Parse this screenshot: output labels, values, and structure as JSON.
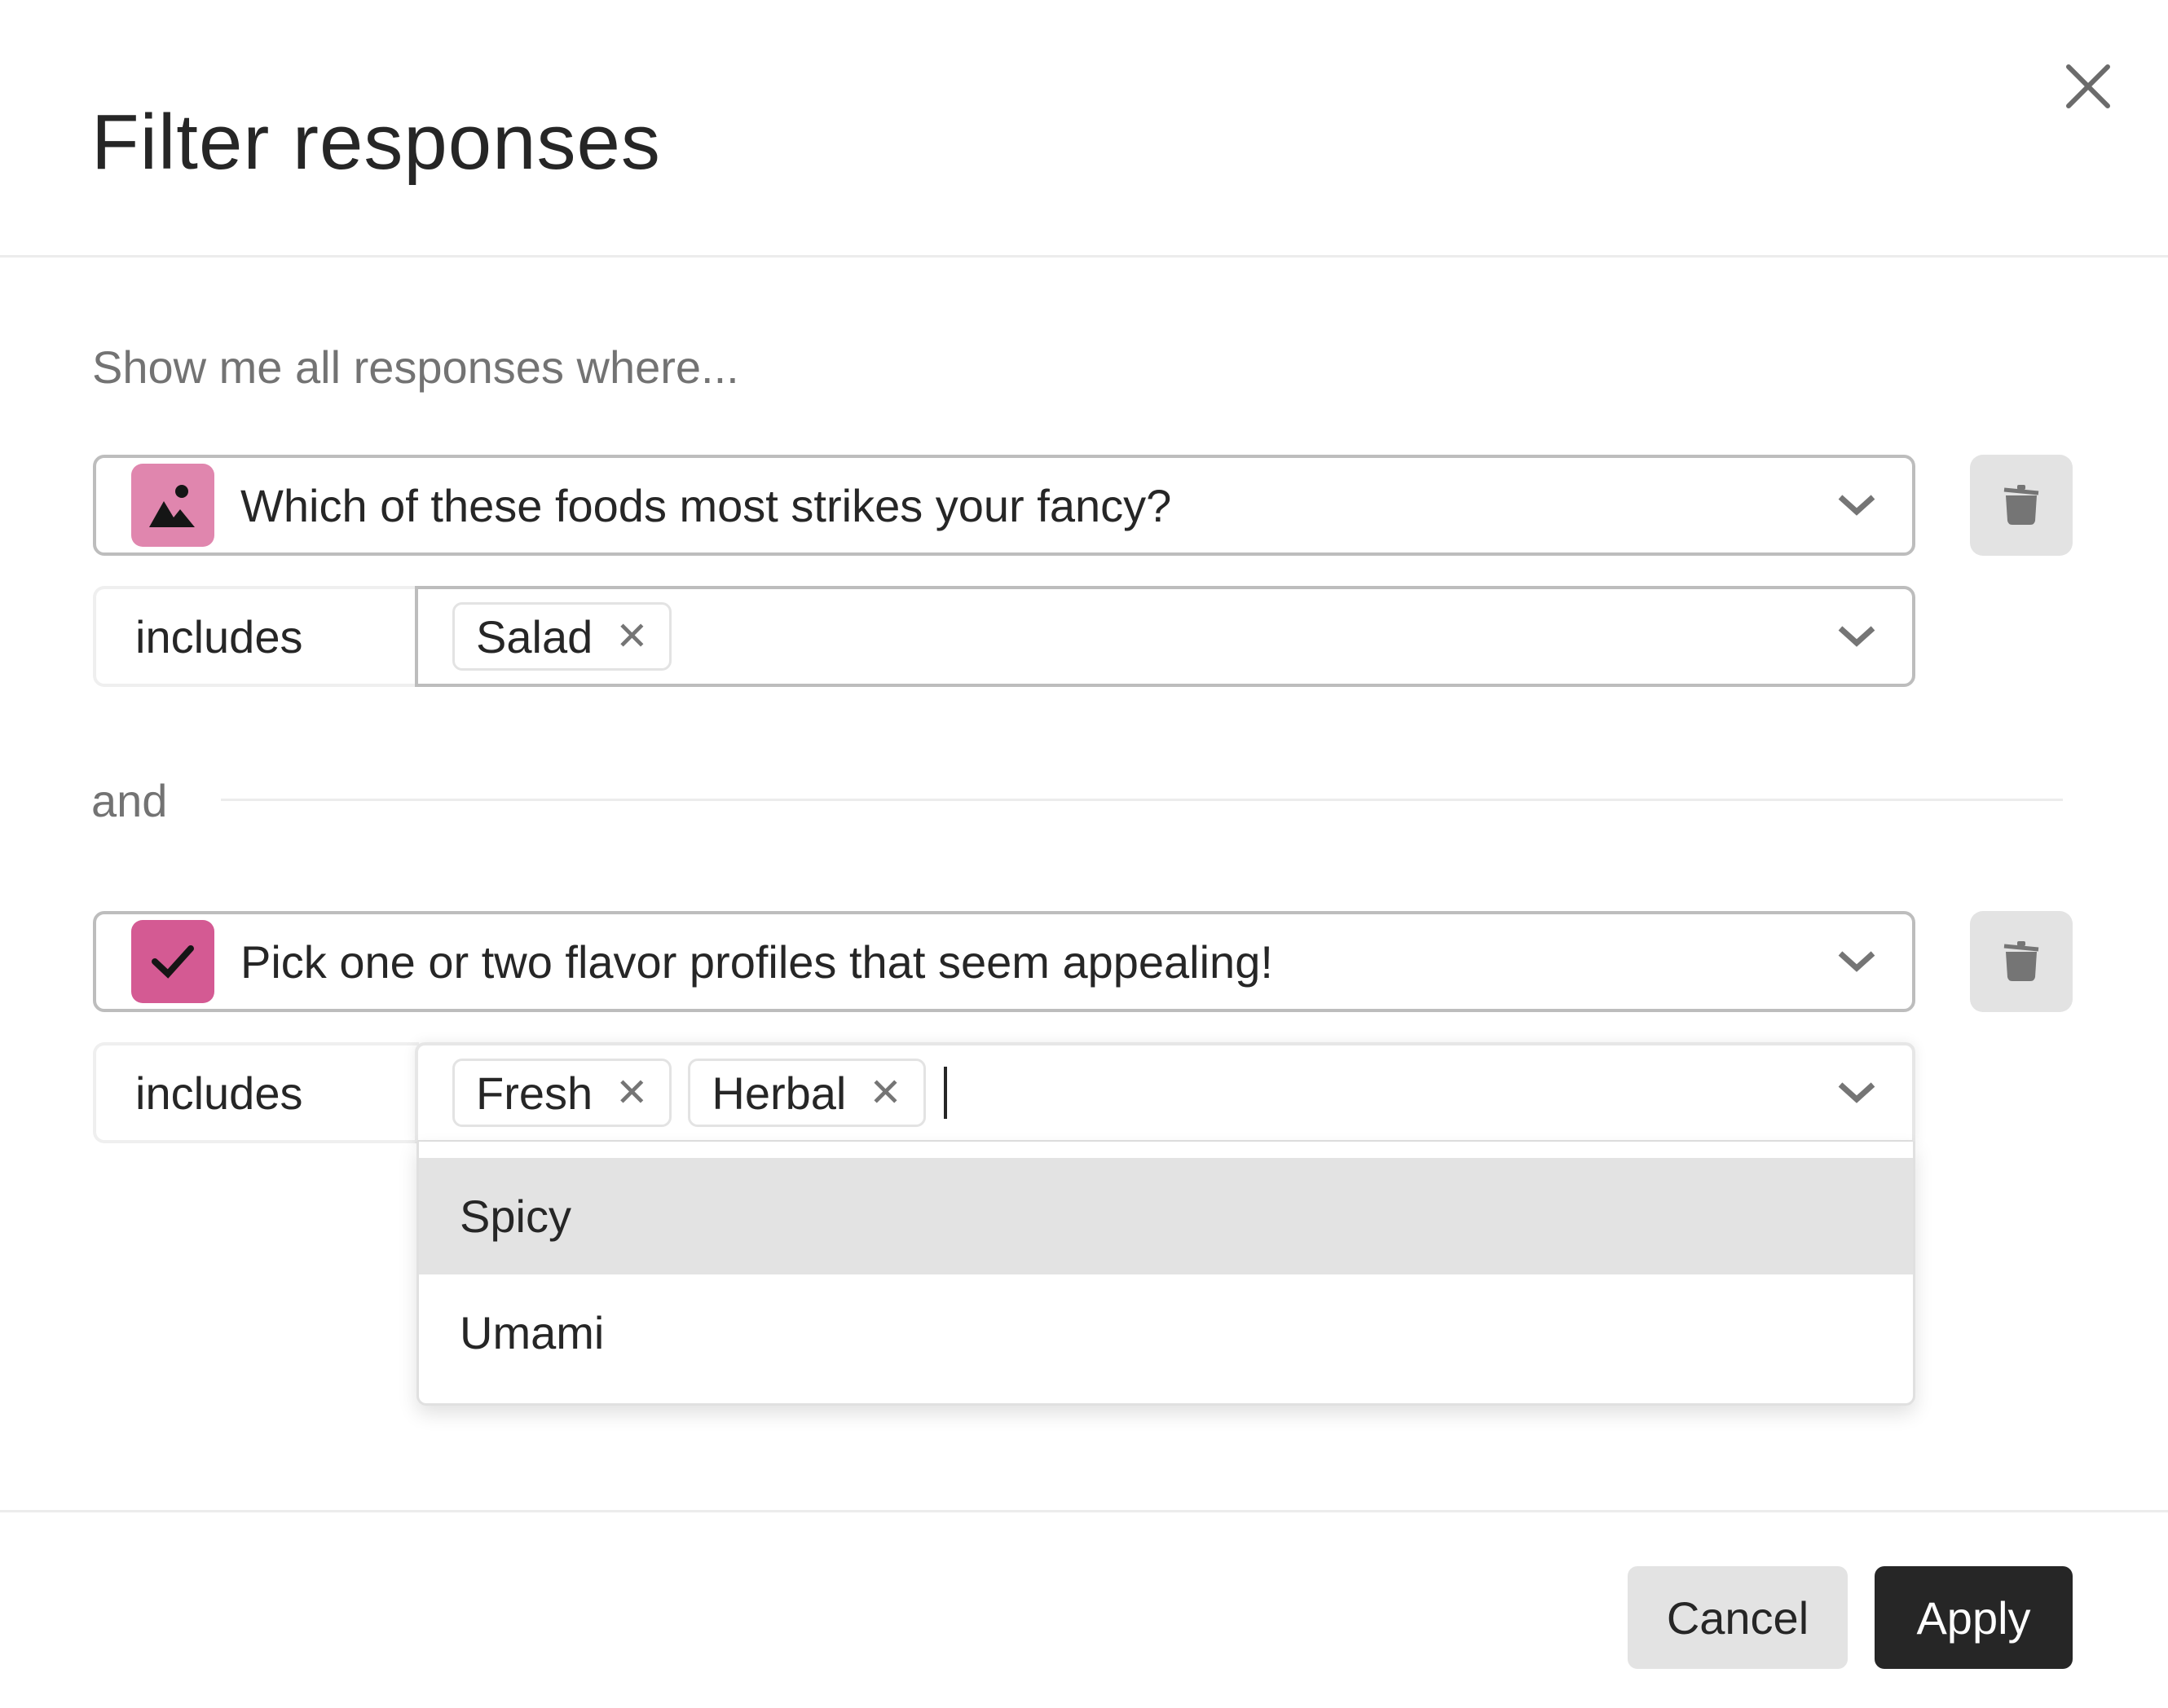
{
  "dialog": {
    "title": "Filter responses",
    "intro": "Show me all responses where...",
    "conjunction": "and"
  },
  "filters": [
    {
      "question": "Which of these foods most strikes your fancy?",
      "question_icon": "image-icon",
      "icon_color": "#e086ae",
      "operator": "includes",
      "values": [
        "Salad"
      ]
    },
    {
      "question": "Pick one or two flavor profiles that seem appealing!",
      "question_icon": "checkmark-icon",
      "icon_color": "#d45a93",
      "operator": "includes",
      "values": [
        "Fresh",
        "Herbal"
      ],
      "dropdown_options": [
        "Spicy",
        "Umami"
      ],
      "highlighted_option": "Spicy"
    }
  ],
  "footer": {
    "cancel_label": "Cancel",
    "apply_label": "Apply"
  }
}
